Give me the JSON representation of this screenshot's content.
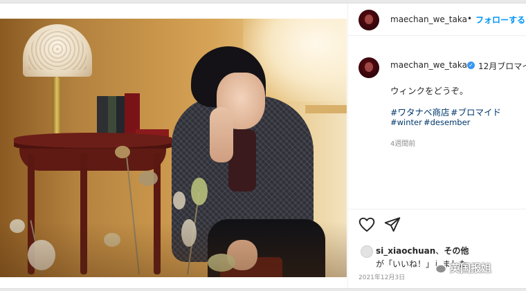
{
  "post": {
    "username": "maechan_we_taka",
    "header_separator": "•",
    "follow_label": "フォローする",
    "caption_username": "maechan_we_taka",
    "caption_start": "12月ブロマイ",
    "caption_line": "ウィンクをどうぞ。",
    "hashtags_line1": [
      "#ワタナベ商店",
      "#ブロマイド"
    ],
    "hashtags_line2": [
      "#winter",
      "#desember"
    ],
    "posted_ago": "4週間前",
    "liked_by_user": "si_xiaochuan",
    "liked_by_sep": "、",
    "liked_by_others": "その他",
    "liked_suffix": "が「いいね！」しました",
    "date": "2021年12月3日"
  },
  "watermark": {
    "text": "英国报姐"
  },
  "colors": {
    "link": "#0095f6",
    "hashtag": "#00376b",
    "meta": "#8e8e8e",
    "verified": "#3897f0"
  },
  "icons": [
    "verified-badge-icon",
    "heart-icon",
    "share-icon",
    "wechat-icon"
  ]
}
